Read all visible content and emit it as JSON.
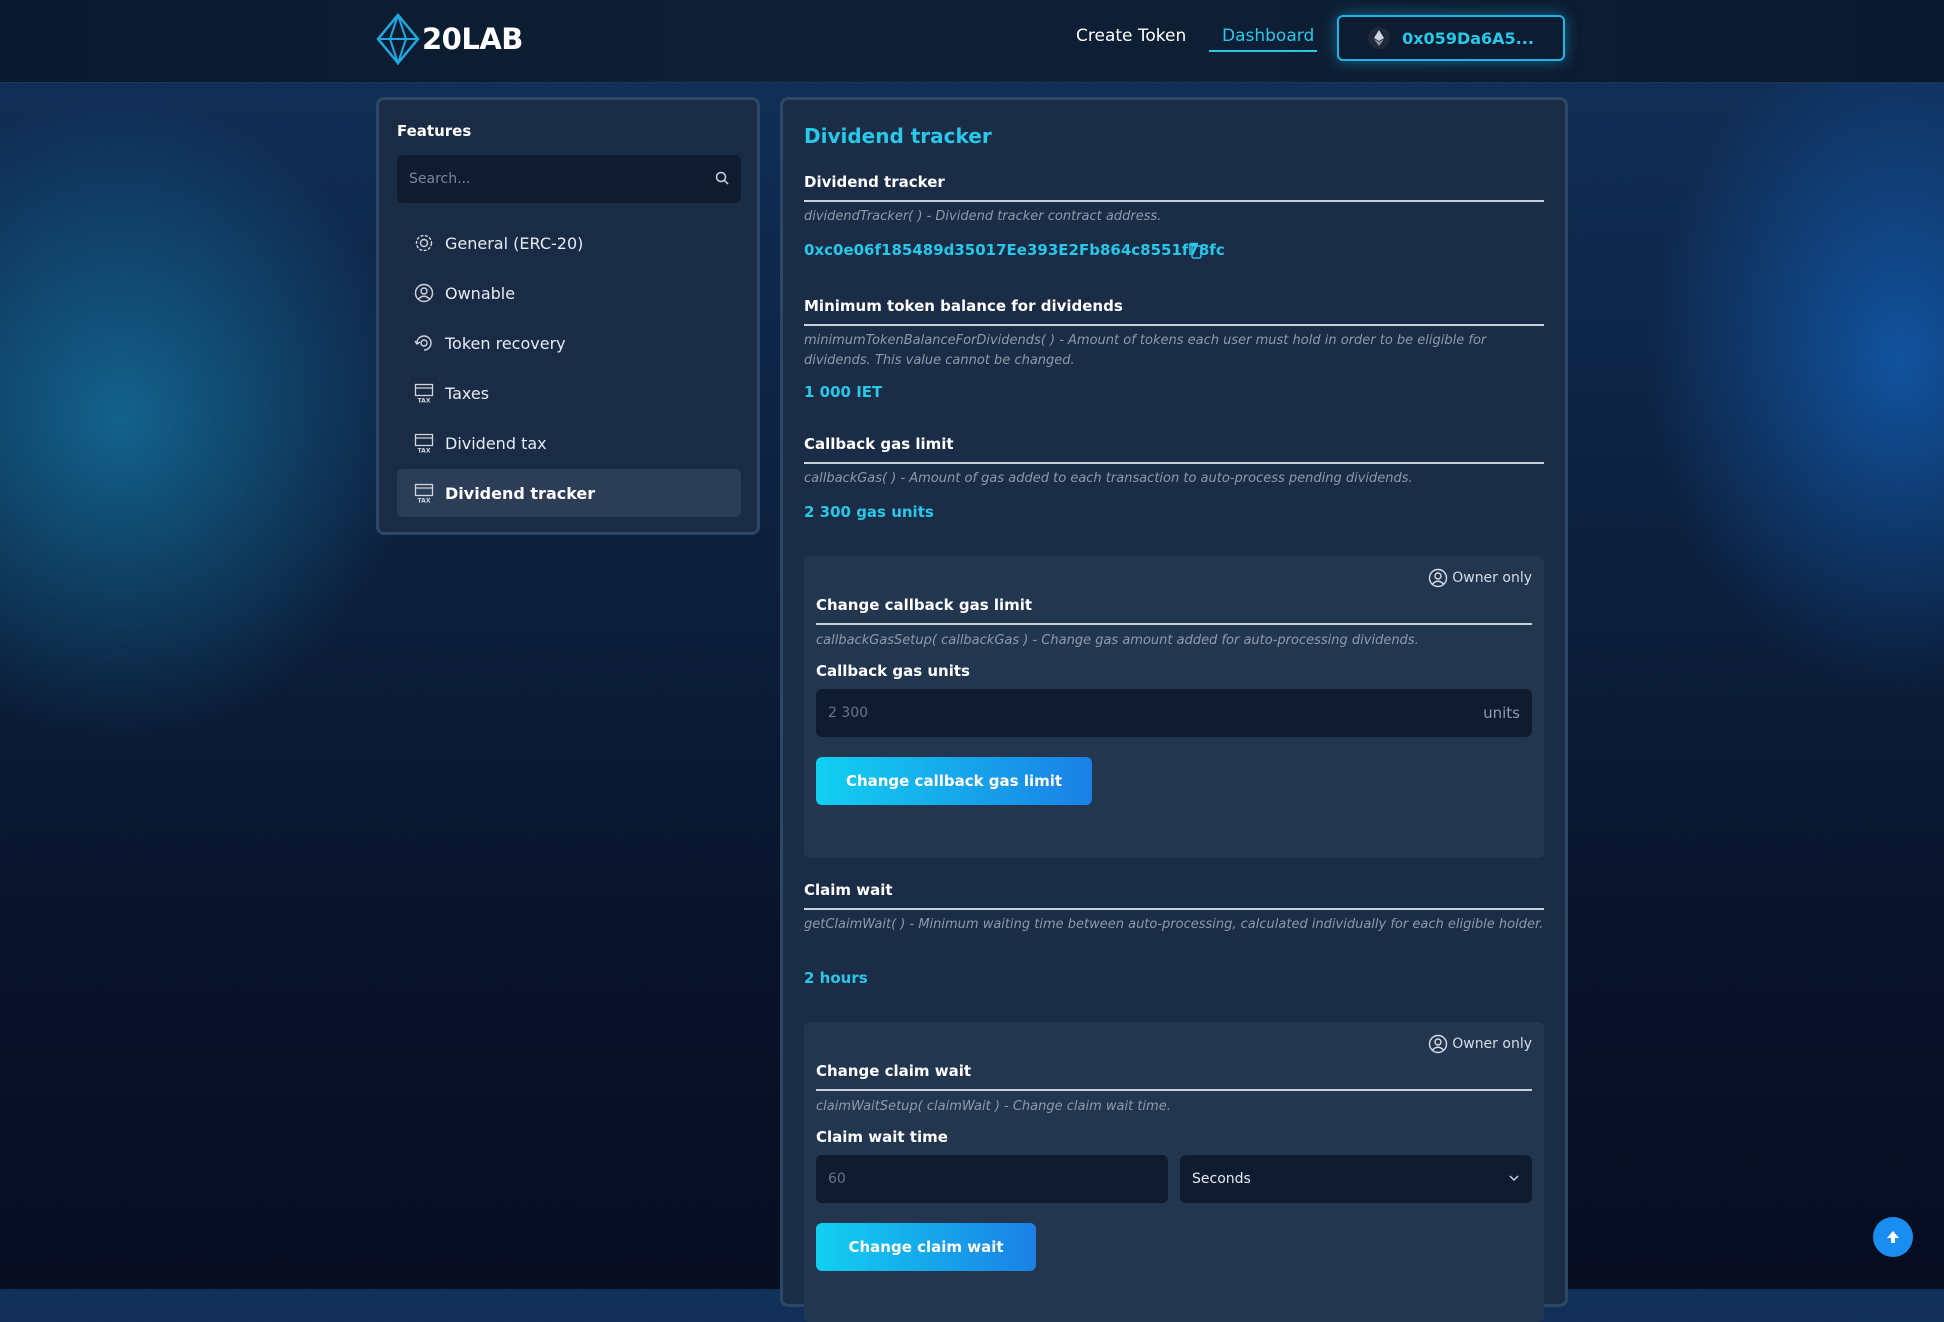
{
  "header": {
    "logo_text": "20LAB",
    "nav": {
      "create_token": "Create Token",
      "dashboard": "Dashboard"
    },
    "wallet_address": "0x059Da6A5..."
  },
  "sidebar": {
    "title": "Features",
    "search_placeholder": "Search...",
    "items": [
      {
        "label": "General (ERC-20)",
        "icon": "gear-icon"
      },
      {
        "label": "Ownable",
        "icon": "user-circle-icon"
      },
      {
        "label": "Token recovery",
        "icon": "recovery-icon"
      },
      {
        "label": "Taxes",
        "icon": "tax-icon"
      },
      {
        "label": "Dividend tax",
        "icon": "tax-icon"
      },
      {
        "label": "Dividend tracker",
        "icon": "tax-icon",
        "active": true
      }
    ]
  },
  "main": {
    "title": "Dividend tracker",
    "sections": {
      "tracker": {
        "title": "Dividend tracker",
        "desc": "dividendTracker( ) - Dividend tracker contract address.",
        "value": "0xc0e06f185489d35017Ee393E2Fb864c8551f78fc"
      },
      "min_balance": {
        "title": "Minimum token balance for dividends",
        "desc": "minimumTokenBalanceForDividends( ) - Amount of tokens each user must hold in order to be eligible for dividends. This value cannot be changed.",
        "value": "1 000 IET"
      },
      "callback_gas": {
        "title": "Callback gas limit",
        "desc": "callbackGas( ) - Amount of gas added to each transaction to auto-process pending dividends.",
        "value": "2 300 gas units"
      },
      "change_gas": {
        "owner_tag": "Owner only",
        "title": "Change callback gas limit",
        "desc": "callbackGasSetup( callbackGas ) - Change gas amount added for auto-processing dividends.",
        "input_label": "Callback gas units",
        "input_placeholder": "2 300",
        "input_unit": "units",
        "button": "Change callback gas limit"
      },
      "claim_wait": {
        "title": "Claim wait",
        "desc": "getClaimWait( ) - Minimum waiting time between auto-processing, calculated individually for each eligible holder.",
        "value": "2 hours"
      },
      "change_claim": {
        "owner_tag": "Owner only",
        "title": "Change claim wait",
        "desc": "claimWaitSetup( claimWait ) - Change claim wait time.",
        "input_label": "Claim wait time",
        "input_placeholder": "60",
        "select_value": "Seconds",
        "button": "Change claim wait"
      }
    }
  },
  "colors": {
    "accent": "#29c7e8",
    "panel": "#1b2c46",
    "owner_box": "#233650",
    "button_start": "#12d0f0",
    "button_end": "#1a80e6"
  }
}
